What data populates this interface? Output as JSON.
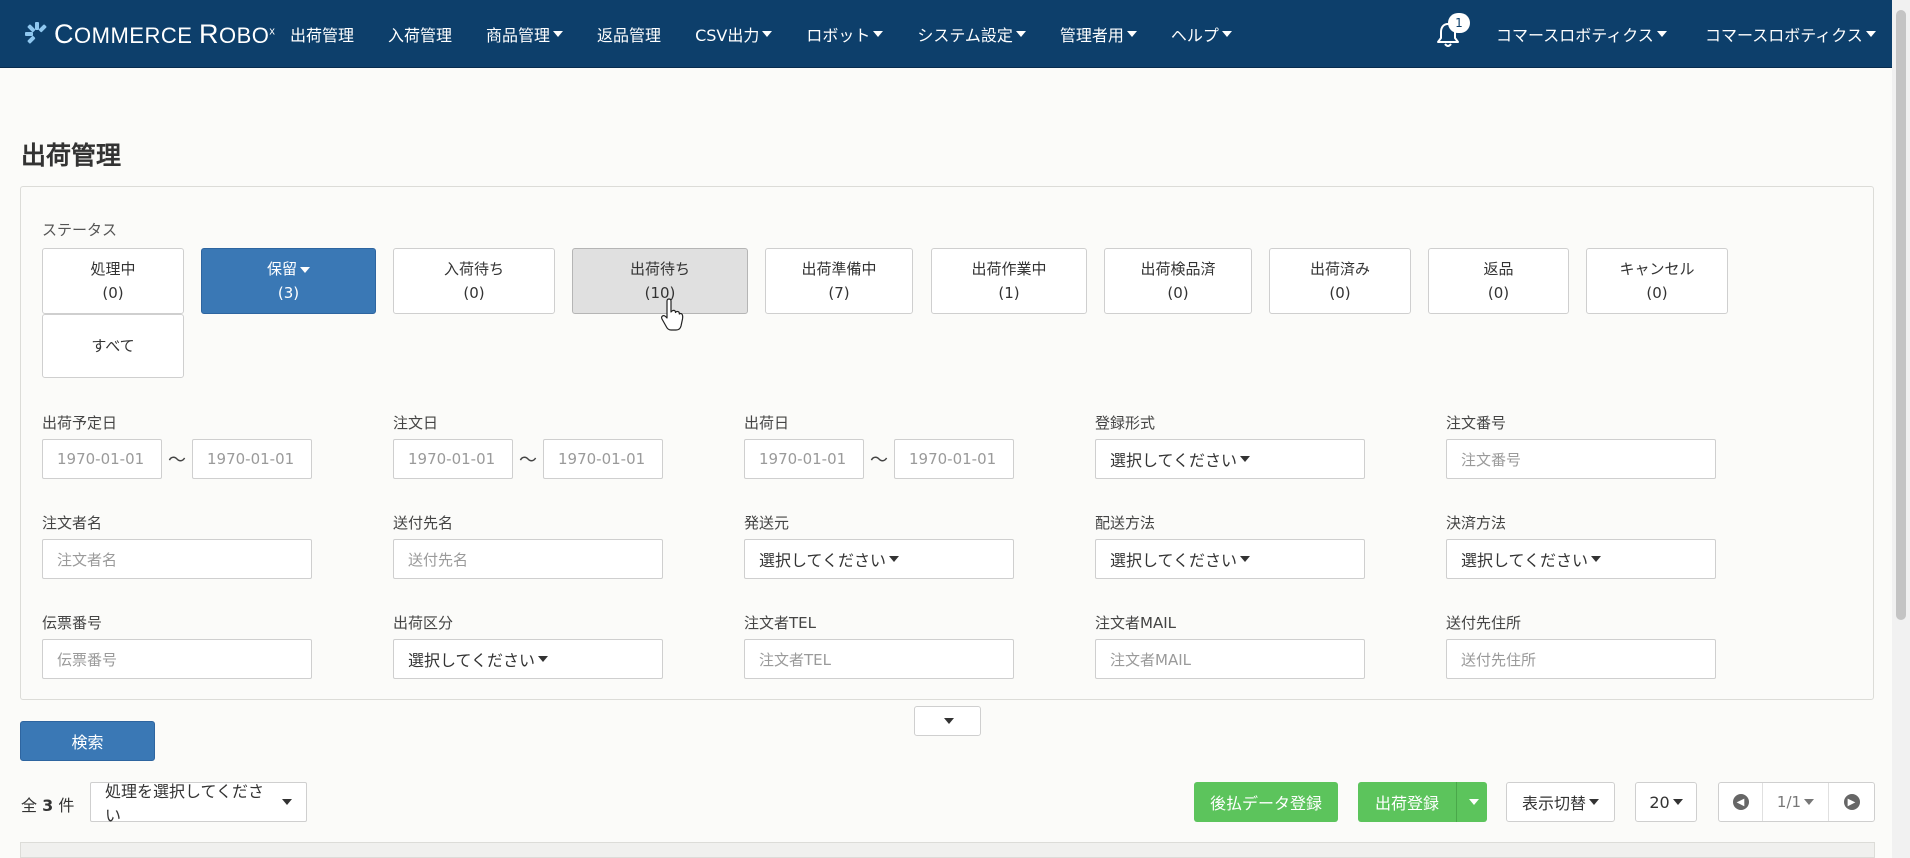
{
  "brand": {
    "text_prefix": "C",
    "text_mid": "OMMERCE ",
    "text_r": "R",
    "text_end": "OBO",
    "mark": "x"
  },
  "nav": {
    "items": [
      {
        "label": "出荷管理",
        "dropdown": false
      },
      {
        "label": "入荷管理",
        "dropdown": false
      },
      {
        "label": "商品管理",
        "dropdown": true
      },
      {
        "label": "返品管理",
        "dropdown": false
      },
      {
        "label": "CSV出力",
        "dropdown": true
      },
      {
        "label": "ロボット",
        "dropdown": true
      },
      {
        "label": "システム設定",
        "dropdown": true
      },
      {
        "label": "管理者用",
        "dropdown": true
      },
      {
        "label": "ヘルプ",
        "dropdown": true
      }
    ],
    "notification_count": "1",
    "user1": "コマースロボティクス",
    "user2": "コマースロボティクス"
  },
  "page": {
    "title": "出荷管理"
  },
  "status": {
    "label": "ステータス",
    "buttons": [
      {
        "name": "処理中",
        "count": "(0)"
      },
      {
        "name": "保留",
        "count": "(3)"
      },
      {
        "name": "入荷待ち",
        "count": "(0)"
      },
      {
        "name": "出荷待ち",
        "count": "(10)"
      },
      {
        "name": "出荷準備中",
        "count": "(7)"
      },
      {
        "name": "出荷作業中",
        "count": "(1)"
      },
      {
        "name": "出荷検品済",
        "count": "(0)"
      },
      {
        "name": "出荷済み",
        "count": "(0)"
      },
      {
        "name": "返品",
        "count": "(0)"
      },
      {
        "name": "キャンセル",
        "count": "(0)"
      },
      {
        "name": "すべて",
        "count": ""
      }
    ]
  },
  "filters": {
    "ship_scheduled": {
      "label": "出荷予定日",
      "from": "1970-01-01",
      "to": "1970-01-01"
    },
    "order_date": {
      "label": "注文日",
      "from": "1970-01-01",
      "to": "1970-01-01"
    },
    "ship_date": {
      "label": "出荷日",
      "from": "1970-01-01",
      "to": "1970-01-01"
    },
    "reg_format": {
      "label": "登録形式",
      "value": "選択してください"
    },
    "order_no": {
      "label": "注文番号",
      "placeholder": "注文番号"
    },
    "orderer_name": {
      "label": "注文者名",
      "placeholder": "注文者名"
    },
    "recipient_name": {
      "label": "送付先名",
      "placeholder": "送付先名"
    },
    "sender": {
      "label": "発送元",
      "value": "選択してください"
    },
    "delivery": {
      "label": "配送方法",
      "value": "選択してください"
    },
    "payment": {
      "label": "決済方法",
      "value": "選択してください"
    },
    "slip_no": {
      "label": "伝票番号",
      "placeholder": "伝票番号"
    },
    "ship_type": {
      "label": "出荷区分",
      "value": "選択してください"
    },
    "orderer_tel": {
      "label": "注文者TEL",
      "placeholder": "注文者TEL"
    },
    "orderer_mail": {
      "label": "注文者MAIL",
      "placeholder": "注文者MAIL"
    },
    "recipient_addr": {
      "label": "送付先住所",
      "placeholder": "送付先住所"
    },
    "tilde": "〜"
  },
  "actions": {
    "search": "検索",
    "total_prefix": "全",
    "total_count": "3",
    "total_suffix": "件",
    "process_select": "処理を選択してください",
    "deferred_payment": "後払データ登録",
    "ship_register": "出荷登録",
    "display_toggle": "表示切替",
    "per_page": "20",
    "page_info": "1/1"
  },
  "colors": {
    "navbar": "#0d3f6b",
    "primary": "#3a78b5",
    "success": "#5cc45c"
  }
}
